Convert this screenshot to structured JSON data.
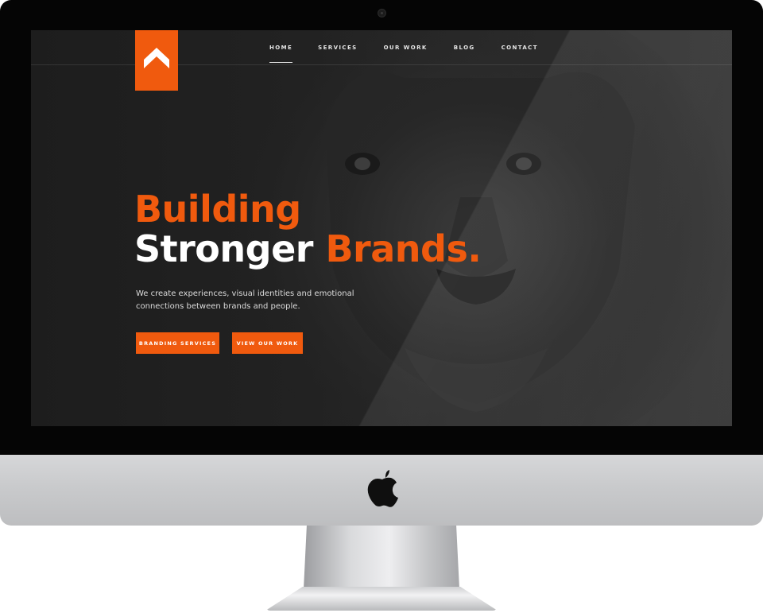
{
  "nav": {
    "items": [
      {
        "label": "HOME",
        "active": true
      },
      {
        "label": "SERVICES",
        "active": false
      },
      {
        "label": "OUR WORK",
        "active": false
      },
      {
        "label": "BLOG",
        "active": false
      },
      {
        "label": "CONTACT",
        "active": false
      }
    ]
  },
  "hero": {
    "headline_line1": "Building",
    "headline_line2_white": "Stronger",
    "headline_line2_orange": "Brands.",
    "subtitle": "We create experiences, visual identities and emotional connections between brands and people.",
    "primary_button": "BRANDING SERVICES",
    "secondary_button": "VIEW OUR WORK"
  },
  "colors": {
    "accent": "#f05a0e",
    "background": "#1f1f1f",
    "text": "#ffffff"
  },
  "icons": {
    "logo": "chevron-up-icon",
    "device": "apple-logo-icon"
  }
}
